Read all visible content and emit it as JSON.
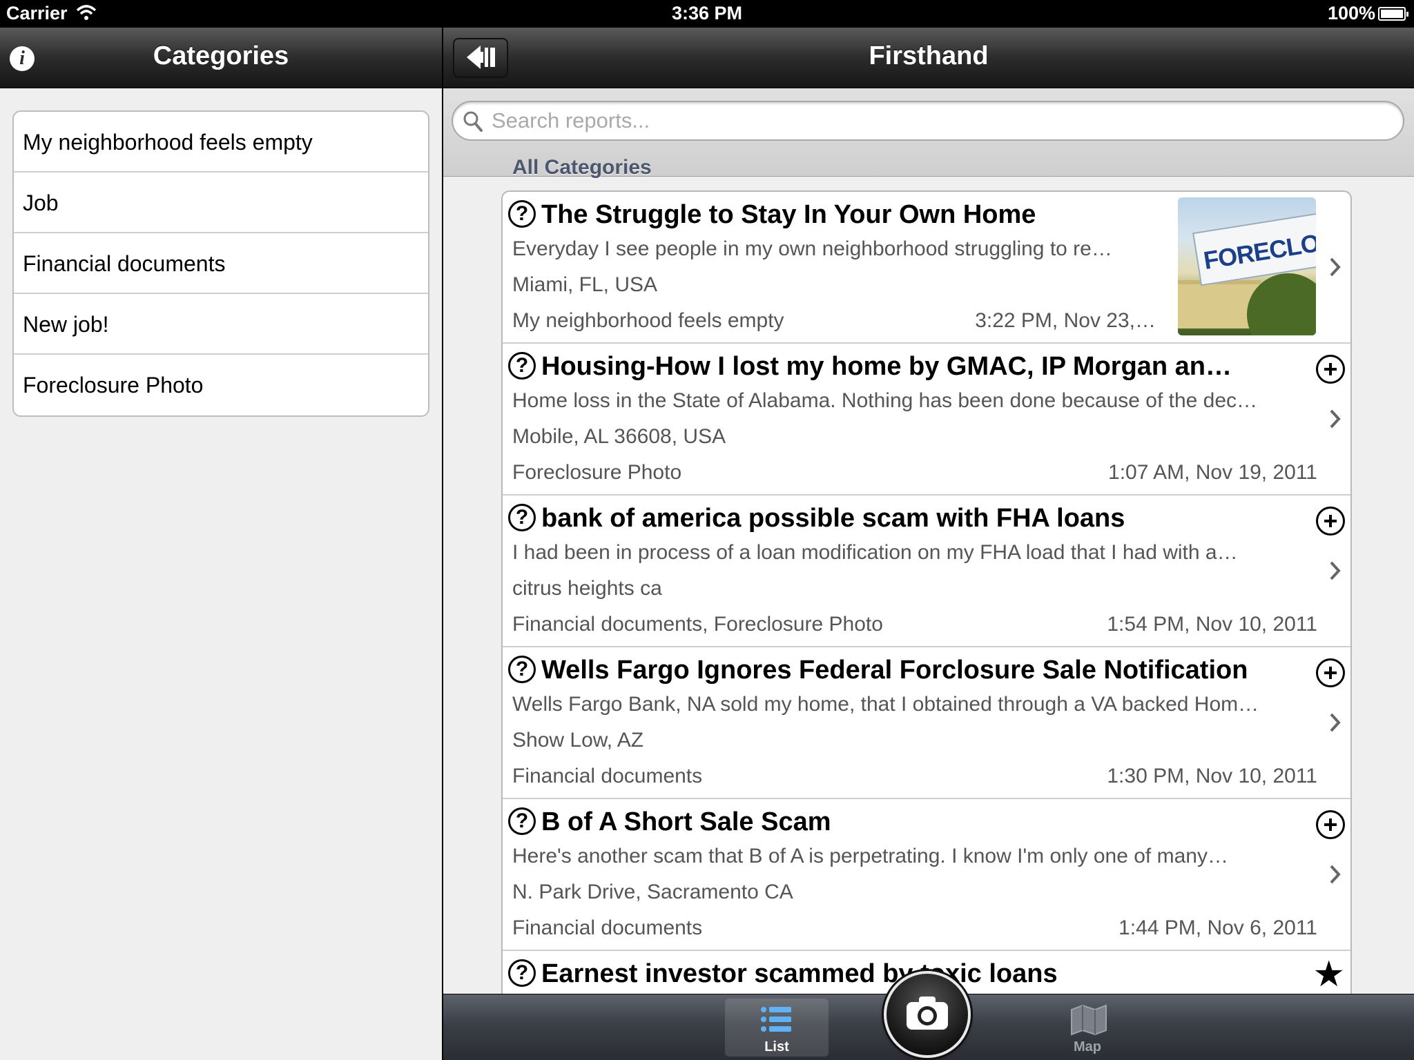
{
  "status_bar": {
    "carrier": "Carrier",
    "time": "3:36 PM",
    "battery": "100%"
  },
  "left_pane": {
    "title": "Categories",
    "categories": [
      "My neighborhood feels empty",
      "Job",
      "Financial documents",
      "New job!",
      "Foreclosure Photo"
    ]
  },
  "right_pane": {
    "title": "Firsthand",
    "search": {
      "placeholder": "Search reports..."
    },
    "section_header": "All Categories",
    "thumbnail_text": "FORECLOSUR",
    "reports": [
      {
        "title": "The Struggle to Stay In Your Own Home",
        "snippet": "Everyday I see people in my own neighborhood struggling to re…",
        "location": "Miami, FL, USA",
        "categories": "My neighborhood feels empty",
        "timestamp": "3:22 PM, Nov 23,…",
        "accessory": "thumbnail"
      },
      {
        "title": "Housing-How I lost my home by GMAC, IP Morgan an…",
        "snippet": "Home loss in the State of Alabama. Nothing has been done because of the dec…",
        "location": "Mobile, AL 36608, USA",
        "categories": "Foreclosure Photo",
        "timestamp": "1:07 AM, Nov 19, 2011",
        "accessory": "plus-circle-icon"
      },
      {
        "title": "bank of america possible  scam with FHA loans",
        "snippet": "I had been in process of a loan modification on my FHA load that I had with a…",
        "location": "citrus heights ca",
        "categories": "Financial documents, Foreclosure Photo",
        "timestamp": "1:54 PM, Nov 10, 2011",
        "accessory": "plus-circle-icon"
      },
      {
        "title": "Wells Fargo Ignores Federal Forclosure Sale Notification",
        "snippet": "Wells Fargo Bank, NA sold my home, that I obtained through a VA backed Hom…",
        "location": "Show Low, AZ",
        "categories": "Financial documents",
        "timestamp": "1:30 PM, Nov 10, 2011",
        "accessory": "plus-circle-icon"
      },
      {
        "title": "B of A Short Sale Scam",
        "snippet": "Here's another scam that B of A is perpetrating.  I know I'm only one of many…",
        "location": "N. Park Drive, Sacramento CA",
        "categories": "Financial documents",
        "timestamp": "1:44 PM, Nov 6, 2011",
        "accessory": "plus-circle-icon"
      },
      {
        "title": "Earnest investor scammed by toxic loans",
        "accessory": "star-icon"
      }
    ]
  },
  "tab_bar": {
    "tabs": [
      "List",
      "Map"
    ],
    "selected": "List"
  },
  "colors": {
    "nav_bar": "#2c2c2c",
    "background": "#efefef",
    "section_header": "#4c566c",
    "secondary_text": "#555555"
  }
}
